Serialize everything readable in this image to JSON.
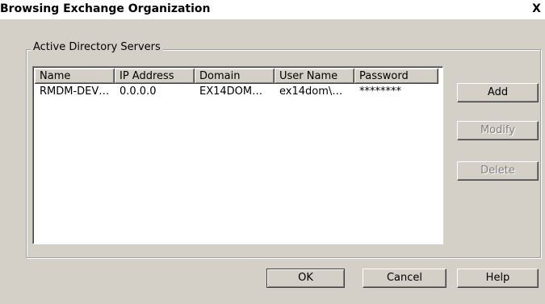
{
  "window": {
    "title": "Browsing Exchange Organization",
    "close_glyph": "X"
  },
  "group": {
    "legend": "Active Directory Servers"
  },
  "list": {
    "columns": [
      "Name",
      "IP Address",
      "Domain",
      "User Name",
      "Password"
    ],
    "rows": [
      [
        "RMDM-DEV…",
        "0.0.0.0",
        "EX14DOM…",
        "ex14dom\\…",
        "********"
      ]
    ]
  },
  "side_buttons": {
    "add": "Add",
    "modify": "Modify",
    "delete": "Delete"
  },
  "footer": {
    "ok": "OK",
    "cancel": "Cancel",
    "help": "Help"
  },
  "icons": {
    "close": "close-icon"
  },
  "colors": {
    "dialog_bg": "#d4d0c8",
    "list_bg": "#ffffff",
    "disabled_text": "#808080"
  }
}
